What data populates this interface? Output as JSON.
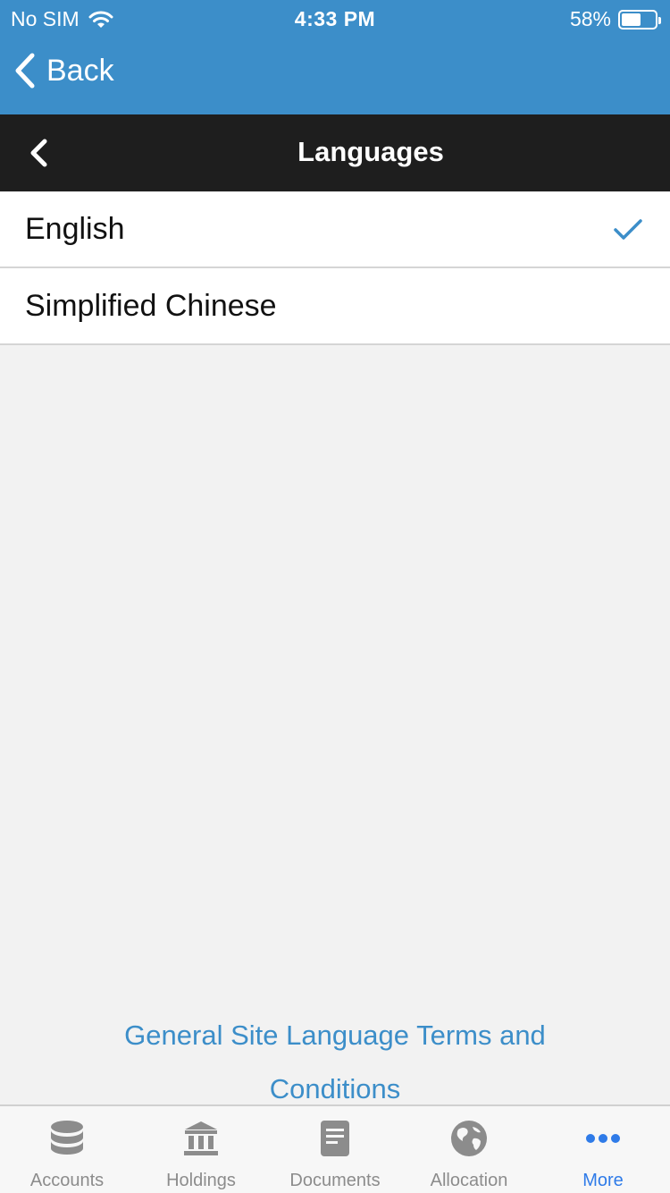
{
  "status_bar": {
    "carrier": "No SIM",
    "time": "4:33 PM",
    "battery_percent_text": "58%",
    "battery_level": 0.58
  },
  "nav": {
    "back_label": "Back"
  },
  "header": {
    "title": "Languages"
  },
  "languages": [
    {
      "label": "English",
      "selected": true
    },
    {
      "label": "Simplified Chinese",
      "selected": false
    }
  ],
  "terms_link": "General Site Language Terms and Conditions",
  "tabs": [
    {
      "label": "Accounts",
      "icon": "database-icon",
      "active": false
    },
    {
      "label": "Holdings",
      "icon": "bank-icon",
      "active": false
    },
    {
      "label": "Documents",
      "icon": "document-icon",
      "active": false
    },
    {
      "label": "Allocation",
      "icon": "globe-icon",
      "active": false
    },
    {
      "label": "More",
      "icon": "more-icon",
      "active": true
    }
  ],
  "colors": {
    "nav_blue": "#3c8ec9",
    "header_dark": "#1e1e1e",
    "active_tab": "#2f7be8",
    "inactive_tab": "#8c8c8c"
  }
}
